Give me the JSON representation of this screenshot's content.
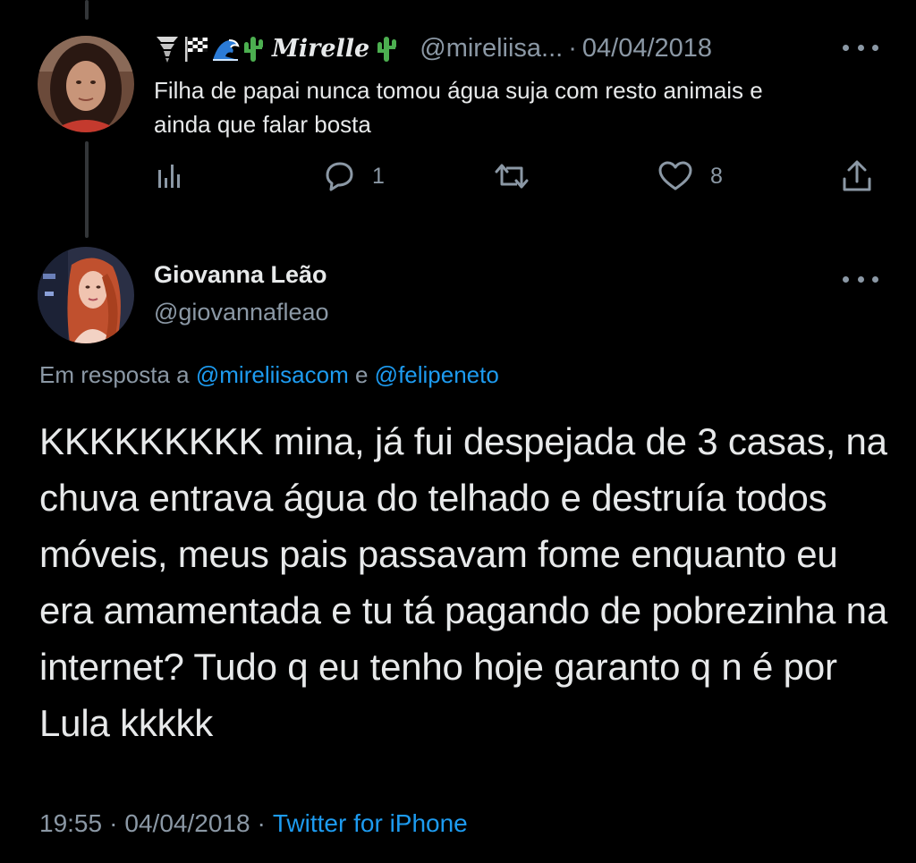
{
  "parent_tweet": {
    "display_name": "Mirelle",
    "name_emojis_before": [
      "tornado-emoji",
      "checkered-flag-emoji",
      "wave-emoji",
      "cactus-emoji"
    ],
    "name_emoji_after": "cactus-emoji",
    "handle": "@mireliisa...",
    "separator": "·",
    "date": "04/04/2018",
    "text": "Filha de papai nunca tomou água suja com resto animais e ainda que falar bosta",
    "actions": {
      "analytics_icon": "bar-chart-icon",
      "reply_icon": "reply-bubble-icon",
      "reply_count": "1",
      "retweet_icon": "retweet-icon",
      "like_icon": "heart-icon",
      "like_count": "8",
      "share_icon": "share-icon"
    }
  },
  "main_tweet": {
    "display_name": "Giovanna Leão",
    "handle": "@giovannafleao",
    "reply_prefix": "Em resposta a",
    "reply_user_1": "@mireliisacom",
    "reply_conjunction": "e",
    "reply_user_2": "@felipeneto",
    "text": "KKKKKKKKK mina, já fui despejada de 3 casas, na chuva entrava água do telhado e destruía todos móveis, meus pais passavam fome enquanto eu era amamentada e tu tá pagando de pobrezinha na internet? Tudo q eu tenho hoje garanto q n é por Lula kkkkk",
    "time": "19:55",
    "separator": "·",
    "date": "04/04/2018",
    "source": "Twitter for iPhone"
  },
  "colors": {
    "background": "#000000",
    "primary_text": "#e7e9ea",
    "secondary_text": "#8b98a5",
    "link": "#1d9bf0",
    "thread_line": "#333639",
    "cactus": "#4caf50"
  }
}
